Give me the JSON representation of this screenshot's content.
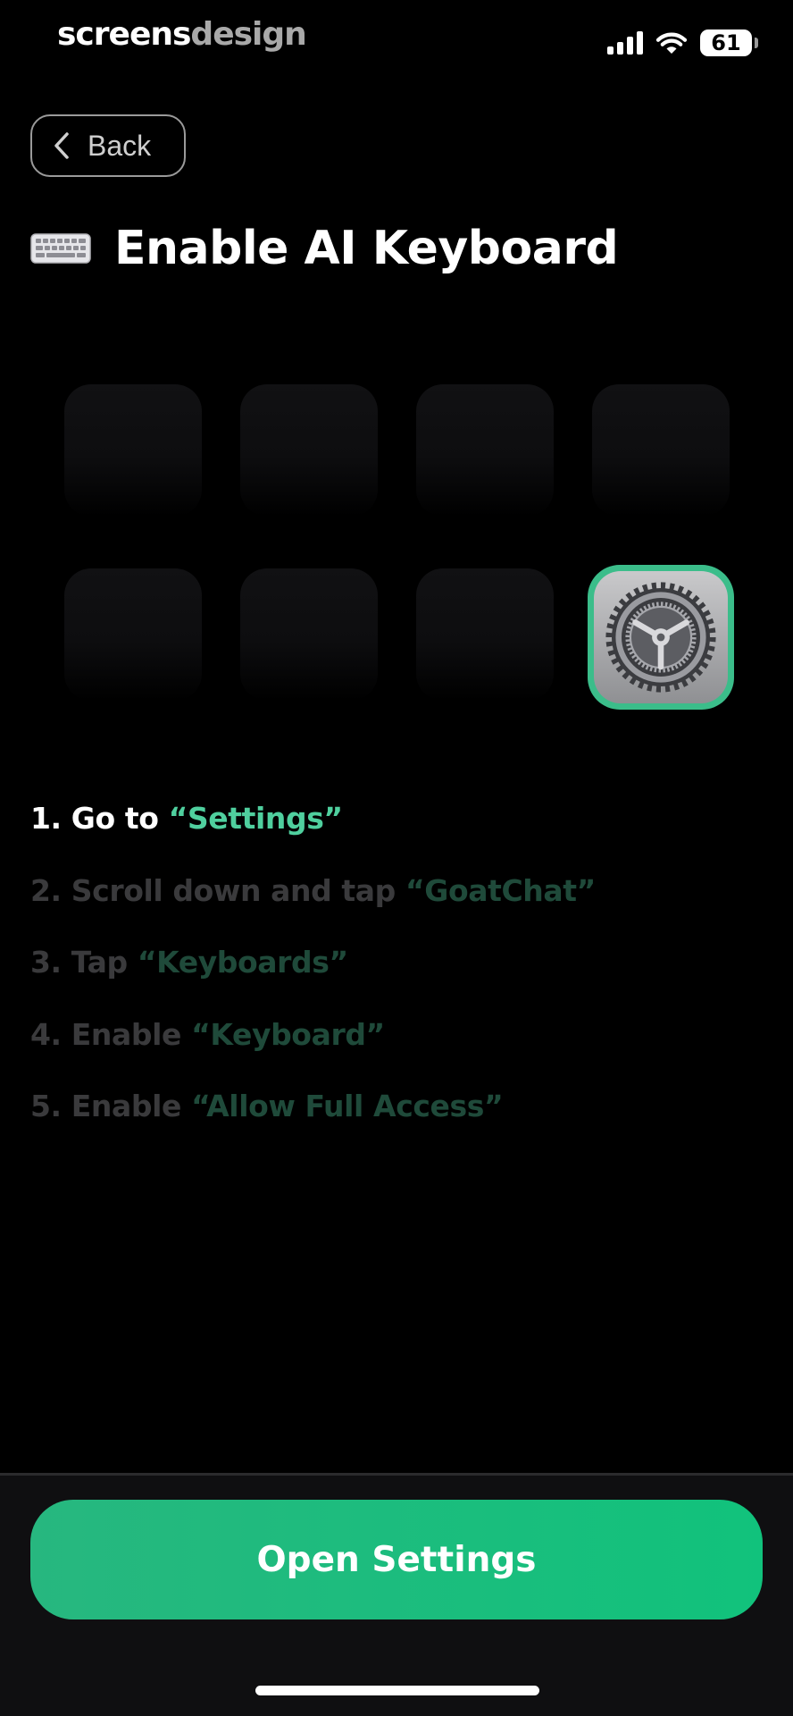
{
  "status_bar": {
    "brand_part1": "screens",
    "brand_part2": "design",
    "battery_level": "61"
  },
  "header": {
    "back_label": "Back",
    "title": "Enable AI Keyboard",
    "title_icon": "keyboard-icon"
  },
  "icons": {
    "settings_app": "settings-gear-icon"
  },
  "steps": [
    {
      "text": "1. Go to ",
      "highlight": "“Settings”",
      "active": true
    },
    {
      "text": "2. Scroll down and tap ",
      "highlight": "“GoatChat”",
      "active": false
    },
    {
      "text": "3. Tap ",
      "highlight": "“Keyboards”",
      "active": false
    },
    {
      "text": "4. Enable ",
      "highlight": "“Keyboard”",
      "active": false
    },
    {
      "text": "5. Enable ",
      "highlight": "“Allow Full Access”",
      "active": false
    }
  ],
  "footer": {
    "button_label": "Open Settings"
  },
  "colors": {
    "accent": "#1dbf7f",
    "highlight": "#4fcf9e",
    "background": "#000000"
  }
}
